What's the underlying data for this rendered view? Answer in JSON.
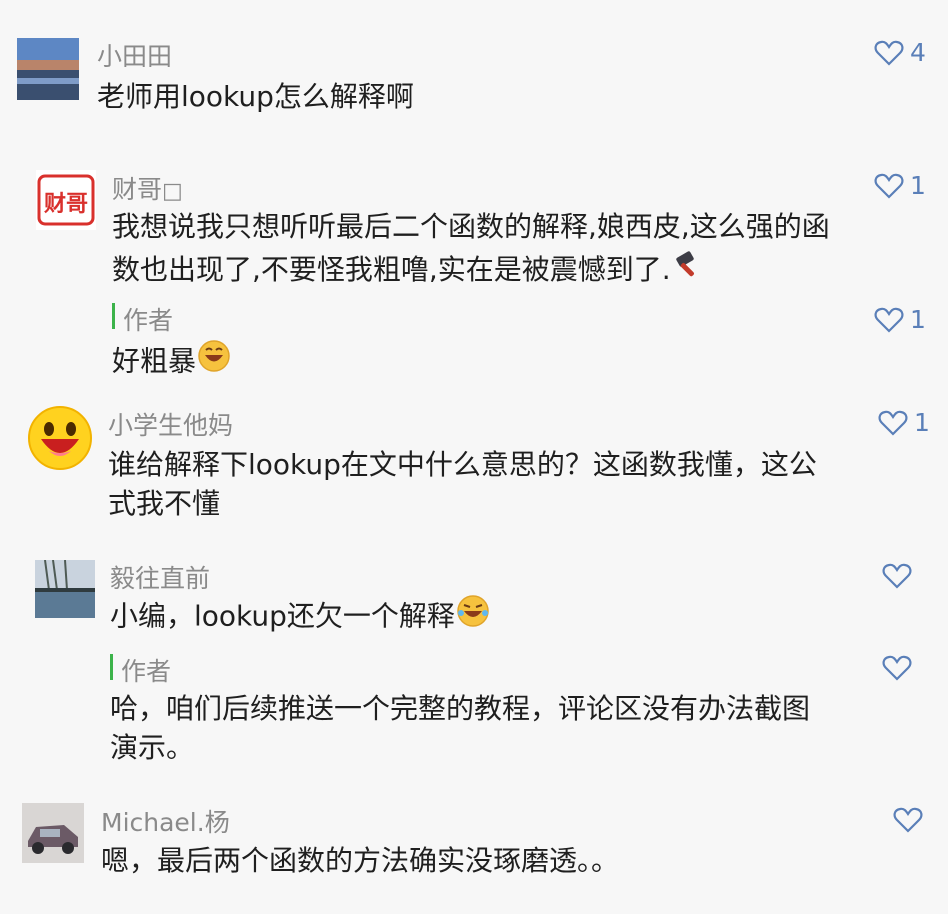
{
  "comments": [
    {
      "name": "小田田",
      "text": "老师用lookup怎么解释啊",
      "likes": "4"
    },
    {
      "name": "财哥",
      "name_box_glyph": "□",
      "text_line1": "我想说我只想听听最后二个函数的解释,娘西皮,这么强的函",
      "text_line2": "数也出现了,不要怪我粗噜,实在是被震憾到了.",
      "likes": "1",
      "avatar_text": "财哥"
    },
    {
      "name": "作者",
      "text": "好粗暴",
      "likes": "1"
    },
    {
      "name": "小学生他妈",
      "text_line1": "谁给解释下lookup在文中什么意思的？这函数我懂，这公",
      "text_line2": "式我不懂",
      "likes": "1"
    },
    {
      "name": "毅往直前",
      "text": "小编，lookup还欠一个解释"
    },
    {
      "name": "作者",
      "text_line1": "哈，咱们后续推送一个完整的教程，评论区没有办法截图",
      "text_line2": "演示。"
    },
    {
      "name": "Michael.杨",
      "text": "嗯，最后两个函数的方法确实没琢磨透。。"
    }
  ],
  "colors": {
    "like": "#5a7fb8",
    "author_bar": "#3cb34a",
    "name": "#8a8a8a",
    "text": "#1f1f1f"
  }
}
